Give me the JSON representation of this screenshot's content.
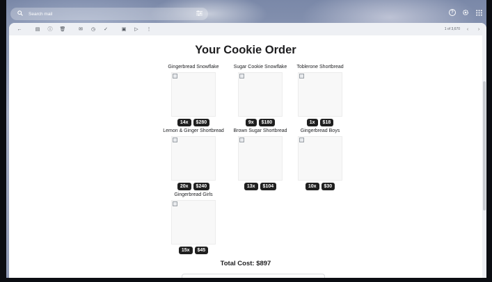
{
  "search": {
    "placeholder": "Search mail"
  },
  "pager": {
    "text": "1 of 3,670"
  },
  "email": {
    "title": "Your Cookie Order",
    "items": [
      {
        "name": "Gingerbread Snowflake",
        "qty": "14x",
        "price": "$280"
      },
      {
        "name": "Sugar Cookie Snowflake",
        "qty": "9x",
        "price": "$180"
      },
      {
        "name": "Toblerone Shortbread",
        "qty": "1x",
        "price": "$18"
      },
      {
        "name": "Lemon & Ginger Shortbread",
        "qty": "20x",
        "price": "$240"
      },
      {
        "name": "Brown Sugar Shortbread",
        "qty": "13x",
        "price": "$104"
      },
      {
        "name": "Gingerbread Boys",
        "qty": "10x",
        "price": "$30"
      },
      {
        "name": "Gingerbread Girls",
        "qty": "15x",
        "price": "$45"
      }
    ],
    "total": "Total Cost: $897"
  },
  "colors": {
    "badge_bg": "#1f1f1f",
    "badge_text": "#ffffff",
    "page_bg": "#ffffff"
  }
}
